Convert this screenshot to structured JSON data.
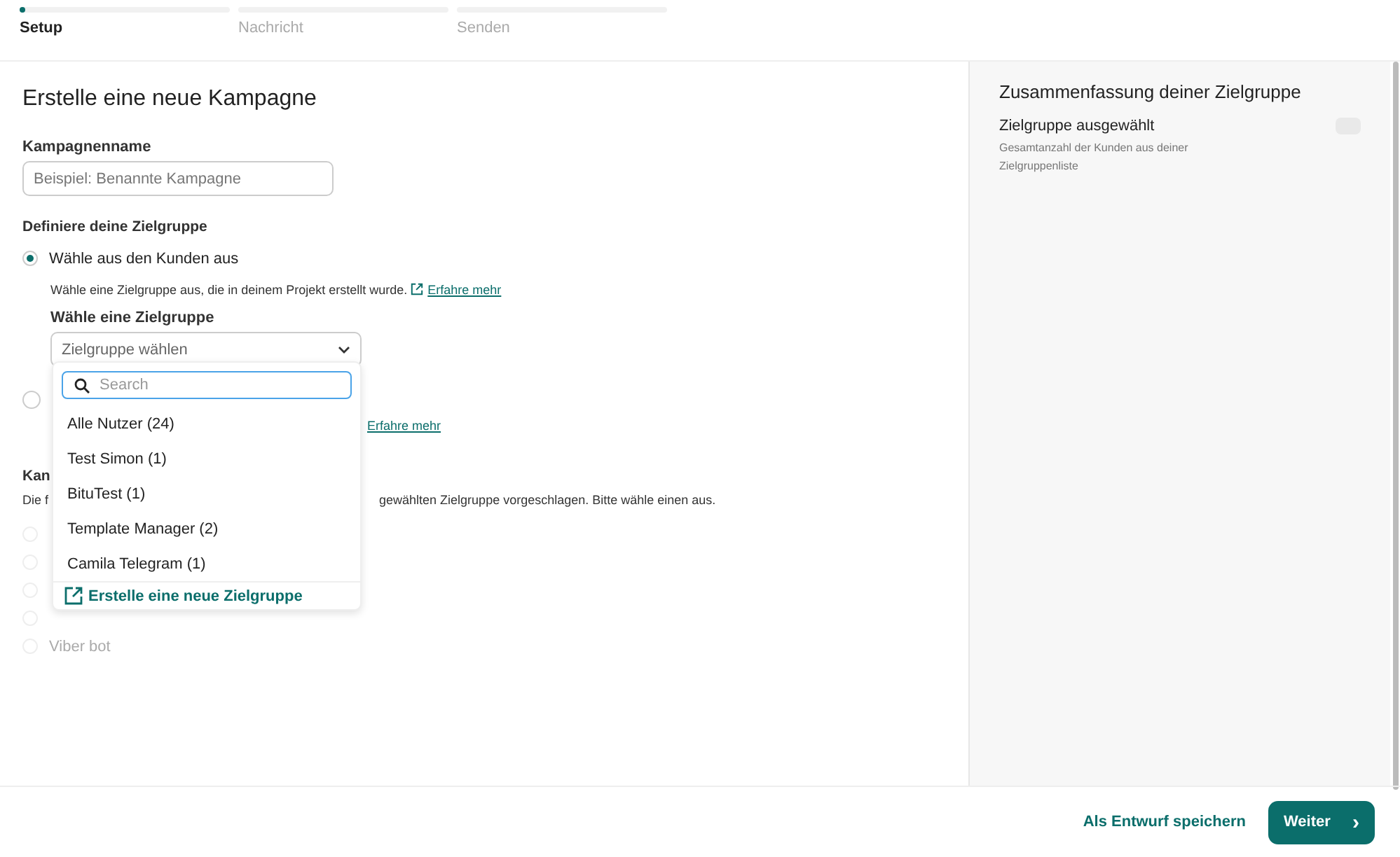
{
  "stepper": [
    {
      "label": "Setup",
      "selected": true
    },
    {
      "label": "Nachricht",
      "selected": false
    },
    {
      "label": "Senden",
      "selected": false
    }
  ],
  "form": {
    "title": "Erstelle eine neue Kampagne",
    "name_label": "Kampagnenname",
    "name_placeholder": "Beispiel: Benannte Kampagne",
    "audience_heading": "Definiere deine Zielgruppe",
    "options": [
      {
        "label": "Wähle aus den Kunden aus",
        "selected": true,
        "hint": "Wähle eine Zielgruppe aus, die in deinem Projekt erstellt wurde.",
        "link": "Erfahre mehr",
        "select_label": "Wähle eine Zielgruppe",
        "select_placeholder": "Zielgruppe wählen"
      },
      {
        "selected": false,
        "link": "Erfahre mehr"
      }
    ],
    "channels_heading": "Kan",
    "channels_hint_start": "Die f",
    "channels_hint_end": "gewählten Zielgruppe vorgeschlagen. Bitte wähle einen aus.",
    "channels": [
      {
        "disabled": true
      },
      {
        "disabled": true
      },
      {
        "disabled": true
      },
      {
        "disabled": true
      },
      {
        "disabled": true,
        "label": "Viber bot"
      }
    ]
  },
  "dropdown": {
    "search_placeholder": "Search",
    "items": [
      "Alle Nutzer (24)",
      "Test Simon (1)",
      "BituTest (1)",
      "Template Manager (2)",
      "Camila Telegram (1)"
    ],
    "create": "Erstelle eine neue Zielgruppe"
  },
  "summary": {
    "title": "Zusammenfassung deiner Zielgruppe",
    "label": "Zielgruppe ausgewählt",
    "on": false,
    "description": "Gesamtanzahl der Kunden aus deiner Zielgruppenliste"
  },
  "footer": {
    "draft": "Als Entwurf speichern",
    "next": "Weiter",
    "next_icon": "›"
  }
}
